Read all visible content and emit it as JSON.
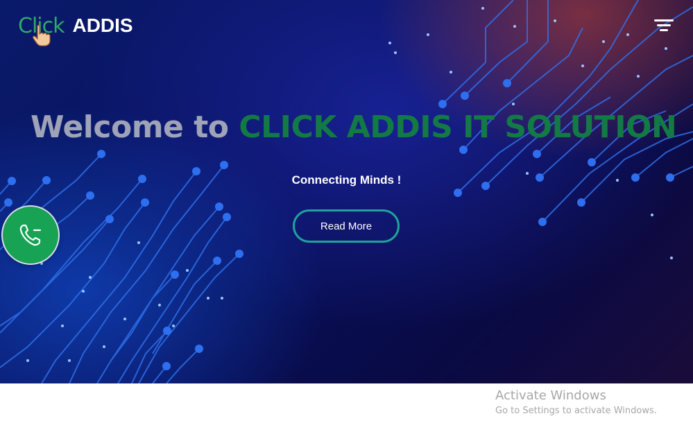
{
  "header": {
    "logo_click": "Click",
    "logo_addis": "ADDIS",
    "menu_icon": "filter-menu-icon"
  },
  "hero": {
    "welcome_prefix": "Welcome to",
    "welcome_brand": "CLICK ADDIS IT SOLUTION",
    "tagline": "Connecting Minds !",
    "button_label": "Read More"
  },
  "contact": {
    "phone_icon": "phone-icon"
  },
  "watermark": {
    "title": "Activate Windows",
    "subtitle": "Go to Settings to activate Windows."
  },
  "colors": {
    "brand_green": "#137a45",
    "logo_green": "#2fa86a",
    "phone_green": "#17a254",
    "button_border": "#1fa39a",
    "hero_background": "#08105a"
  }
}
